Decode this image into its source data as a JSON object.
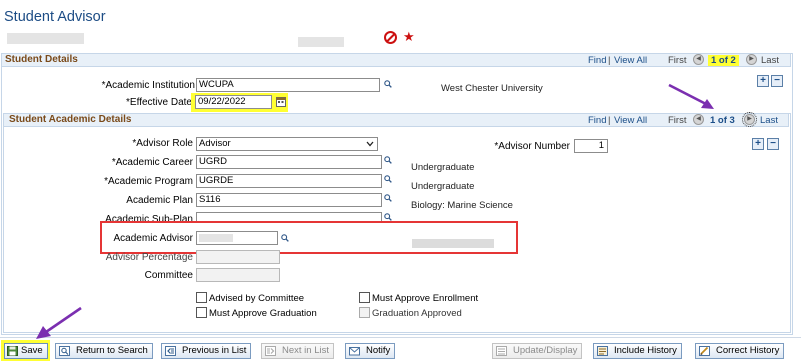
{
  "page": {
    "title": "Student Advisor"
  },
  "colors": {
    "accent": "#1c4c85",
    "section_header": "#7a4a1a",
    "highlight": "#ffff33",
    "callout": "#e53535",
    "arrow": "#7b2fb0"
  },
  "student_details": {
    "header": "Student Details",
    "nav": {
      "find": "Find",
      "sep": "|",
      "view_all": "View All",
      "first": "First",
      "position": "1 of 2",
      "last": "Last"
    },
    "institution_label": "*Academic Institution",
    "institution_value": "WCUPA",
    "institution_desc": "West Chester University",
    "effdt_label": "*Effective Date",
    "effdt_value": "09/22/2022"
  },
  "academic_details": {
    "header": "Student Academic Details",
    "nav": {
      "find": "Find",
      "sep": "|",
      "view_all": "View All",
      "first": "First",
      "position": "1 of 3",
      "last": "Last"
    },
    "advisor_role_label": "*Advisor Role",
    "advisor_role_value": "Advisor",
    "advisor_number_label": "*Advisor Number",
    "advisor_number_value": "1",
    "career_label": "*Academic Career",
    "career_value": "UGRD",
    "career_desc": "Undergraduate",
    "program_label": "*Academic Program",
    "program_value": "UGRDE",
    "program_desc": "Undergraduate",
    "plan_label": "Academic Plan",
    "plan_value": "S116",
    "plan_desc": "Biology: Marine Science",
    "subplan_label": "Academic Sub-Plan",
    "advisor_label": "Academic Advisor",
    "percentage_label": "Advisor Percentage",
    "committee_label": "Committee",
    "cb_advised_by_committee": "Advised by Committee",
    "cb_must_approve_enrollment": "Must Approve Enrollment",
    "cb_must_approve_graduation": "Must Approve Graduation",
    "cb_graduation_approved": "Graduation Approved"
  },
  "toolbar": {
    "save": "Save",
    "return_to_search": "Return to Search",
    "previous_in_list": "Previous in List",
    "next_in_list": "Next in List",
    "notify": "Notify",
    "update_display": "Update/Display",
    "include_history": "Include History",
    "correct_history": "Correct History"
  },
  "icons": [
    "prohibit-icon",
    "required-star-icon",
    "lookup-icon",
    "calendar-icon",
    "save-icon",
    "return-icon",
    "previous-icon",
    "next-icon",
    "notify-icon",
    "update-icon",
    "history-icon",
    "correct-history-icon"
  ]
}
